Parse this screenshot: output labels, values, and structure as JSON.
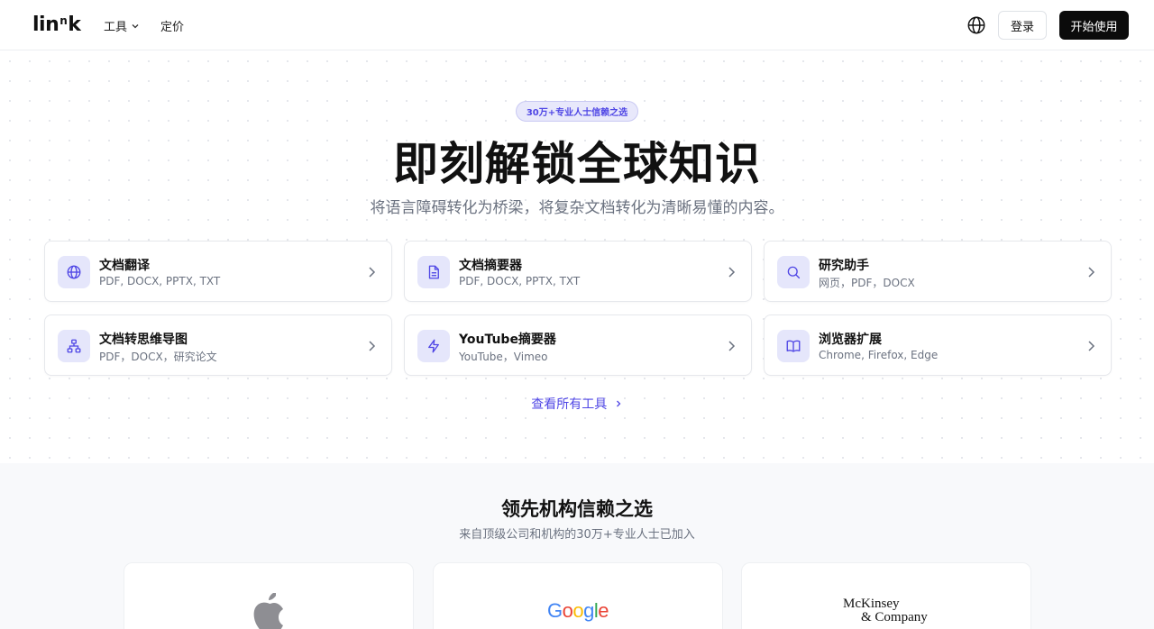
{
  "nav": {
    "logo": {
      "part1": "lin",
      "sup": "n",
      "part2": "k"
    },
    "tools_label": "工具",
    "pricing_label": "定价",
    "login_label": "登录",
    "start_label": "开始使用"
  },
  "hero": {
    "badge": "30万+专业人士信赖之选",
    "title": "即刻解锁全球知识",
    "subtitle": "将语言障碍转化为桥梁，将复杂文档转化为清晰易懂的内容。",
    "view_all": "查看所有工具"
  },
  "tools": [
    {
      "title": "文档翻译",
      "desc": "PDF, DOCX, PPTX, TXT",
      "icon": "globe-icon"
    },
    {
      "title": "文档摘要器",
      "desc": "PDF, DOCX, PPTX, TXT",
      "icon": "document-icon"
    },
    {
      "title": "研究助手",
      "desc": "网页，PDF，DOCX",
      "icon": "search-icon"
    },
    {
      "title": "文档转思维导图",
      "desc": "PDF，DOCX，研究论文",
      "icon": "mindmap-icon"
    },
    {
      "title": "YouTube摘要器",
      "desc": "YouTube，Vimeo",
      "icon": "lightning-icon"
    },
    {
      "title": "浏览器扩展",
      "desc": "Chrome, Firefox, Edge",
      "icon": "book-icon"
    }
  ],
  "trusted": {
    "title": "领先机构信赖之选",
    "subtitle": "来自顶级公司和机构的30万+专业人士已加入",
    "logos": {
      "google": [
        "G",
        "o",
        "o",
        "g",
        "l",
        "e"
      ],
      "mckinsey_line1": "McKinsey",
      "mckinsey_line2": "& Company"
    }
  },
  "colors": {
    "accent": "#4f46e5",
    "icon_bg": "#e5e6fb",
    "google": [
      "#4285F4",
      "#EA4335",
      "#FBBC05",
      "#4285F4",
      "#34A853",
      "#EA4335"
    ]
  }
}
